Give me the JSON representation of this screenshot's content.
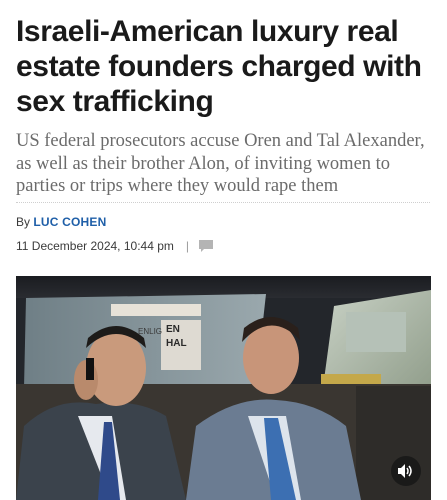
{
  "article": {
    "headline": "Israeli-American luxury real estate founders charged with sex trafficking",
    "standfirst": "US federal prosecutors accuse Oren and Tal Alexander, as well as their brother Alon, of inviting women to parties or trips where they would rape them",
    "byline_prefix": "By",
    "author": "LUC COHEN",
    "date": "11 December 2024, 10:44 pm",
    "separator": "|"
  },
  "photo": {
    "sign_text_1": "ENLIG",
    "sign_text_2": "EN",
    "sign_text_3": "HAL"
  },
  "icons": {
    "comment": "comment-icon",
    "audio": "speaker-icon"
  },
  "colors": {
    "author": "#1f5fa8",
    "headline": "#1a1a1a",
    "standfirst": "#6b6b6b"
  }
}
